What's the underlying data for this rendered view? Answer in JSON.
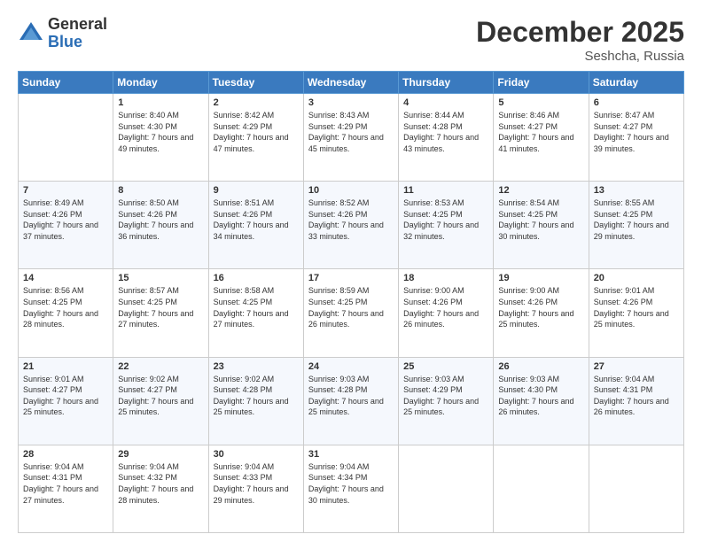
{
  "header": {
    "logo_general": "General",
    "logo_blue": "Blue",
    "month_title": "December 2025",
    "location": "Seshcha, Russia"
  },
  "weekdays": [
    "Sunday",
    "Monday",
    "Tuesday",
    "Wednesday",
    "Thursday",
    "Friday",
    "Saturday"
  ],
  "weeks": [
    [
      {
        "day": "",
        "sunrise": "",
        "sunset": "",
        "daylight": ""
      },
      {
        "day": "1",
        "sunrise": "Sunrise: 8:40 AM",
        "sunset": "Sunset: 4:30 PM",
        "daylight": "Daylight: 7 hours and 49 minutes."
      },
      {
        "day": "2",
        "sunrise": "Sunrise: 8:42 AM",
        "sunset": "Sunset: 4:29 PM",
        "daylight": "Daylight: 7 hours and 47 minutes."
      },
      {
        "day": "3",
        "sunrise": "Sunrise: 8:43 AM",
        "sunset": "Sunset: 4:29 PM",
        "daylight": "Daylight: 7 hours and 45 minutes."
      },
      {
        "day": "4",
        "sunrise": "Sunrise: 8:44 AM",
        "sunset": "Sunset: 4:28 PM",
        "daylight": "Daylight: 7 hours and 43 minutes."
      },
      {
        "day": "5",
        "sunrise": "Sunrise: 8:46 AM",
        "sunset": "Sunset: 4:27 PM",
        "daylight": "Daylight: 7 hours and 41 minutes."
      },
      {
        "day": "6",
        "sunrise": "Sunrise: 8:47 AM",
        "sunset": "Sunset: 4:27 PM",
        "daylight": "Daylight: 7 hours and 39 minutes."
      }
    ],
    [
      {
        "day": "7",
        "sunrise": "Sunrise: 8:49 AM",
        "sunset": "Sunset: 4:26 PM",
        "daylight": "Daylight: 7 hours and 37 minutes."
      },
      {
        "day": "8",
        "sunrise": "Sunrise: 8:50 AM",
        "sunset": "Sunset: 4:26 PM",
        "daylight": "Daylight: 7 hours and 36 minutes."
      },
      {
        "day": "9",
        "sunrise": "Sunrise: 8:51 AM",
        "sunset": "Sunset: 4:26 PM",
        "daylight": "Daylight: 7 hours and 34 minutes."
      },
      {
        "day": "10",
        "sunrise": "Sunrise: 8:52 AM",
        "sunset": "Sunset: 4:26 PM",
        "daylight": "Daylight: 7 hours and 33 minutes."
      },
      {
        "day": "11",
        "sunrise": "Sunrise: 8:53 AM",
        "sunset": "Sunset: 4:25 PM",
        "daylight": "Daylight: 7 hours and 32 minutes."
      },
      {
        "day": "12",
        "sunrise": "Sunrise: 8:54 AM",
        "sunset": "Sunset: 4:25 PM",
        "daylight": "Daylight: 7 hours and 30 minutes."
      },
      {
        "day": "13",
        "sunrise": "Sunrise: 8:55 AM",
        "sunset": "Sunset: 4:25 PM",
        "daylight": "Daylight: 7 hours and 29 minutes."
      }
    ],
    [
      {
        "day": "14",
        "sunrise": "Sunrise: 8:56 AM",
        "sunset": "Sunset: 4:25 PM",
        "daylight": "Daylight: 7 hours and 28 minutes."
      },
      {
        "day": "15",
        "sunrise": "Sunrise: 8:57 AM",
        "sunset": "Sunset: 4:25 PM",
        "daylight": "Daylight: 7 hours and 27 minutes."
      },
      {
        "day": "16",
        "sunrise": "Sunrise: 8:58 AM",
        "sunset": "Sunset: 4:25 PM",
        "daylight": "Daylight: 7 hours and 27 minutes."
      },
      {
        "day": "17",
        "sunrise": "Sunrise: 8:59 AM",
        "sunset": "Sunset: 4:25 PM",
        "daylight": "Daylight: 7 hours and 26 minutes."
      },
      {
        "day": "18",
        "sunrise": "Sunrise: 9:00 AM",
        "sunset": "Sunset: 4:26 PM",
        "daylight": "Daylight: 7 hours and 26 minutes."
      },
      {
        "day": "19",
        "sunrise": "Sunrise: 9:00 AM",
        "sunset": "Sunset: 4:26 PM",
        "daylight": "Daylight: 7 hours and 25 minutes."
      },
      {
        "day": "20",
        "sunrise": "Sunrise: 9:01 AM",
        "sunset": "Sunset: 4:26 PM",
        "daylight": "Daylight: 7 hours and 25 minutes."
      }
    ],
    [
      {
        "day": "21",
        "sunrise": "Sunrise: 9:01 AM",
        "sunset": "Sunset: 4:27 PM",
        "daylight": "Daylight: 7 hours and 25 minutes."
      },
      {
        "day": "22",
        "sunrise": "Sunrise: 9:02 AM",
        "sunset": "Sunset: 4:27 PM",
        "daylight": "Daylight: 7 hours and 25 minutes."
      },
      {
        "day": "23",
        "sunrise": "Sunrise: 9:02 AM",
        "sunset": "Sunset: 4:28 PM",
        "daylight": "Daylight: 7 hours and 25 minutes."
      },
      {
        "day": "24",
        "sunrise": "Sunrise: 9:03 AM",
        "sunset": "Sunset: 4:28 PM",
        "daylight": "Daylight: 7 hours and 25 minutes."
      },
      {
        "day": "25",
        "sunrise": "Sunrise: 9:03 AM",
        "sunset": "Sunset: 4:29 PM",
        "daylight": "Daylight: 7 hours and 25 minutes."
      },
      {
        "day": "26",
        "sunrise": "Sunrise: 9:03 AM",
        "sunset": "Sunset: 4:30 PM",
        "daylight": "Daylight: 7 hours and 26 minutes."
      },
      {
        "day": "27",
        "sunrise": "Sunrise: 9:04 AM",
        "sunset": "Sunset: 4:31 PM",
        "daylight": "Daylight: 7 hours and 26 minutes."
      }
    ],
    [
      {
        "day": "28",
        "sunrise": "Sunrise: 9:04 AM",
        "sunset": "Sunset: 4:31 PM",
        "daylight": "Daylight: 7 hours and 27 minutes."
      },
      {
        "day": "29",
        "sunrise": "Sunrise: 9:04 AM",
        "sunset": "Sunset: 4:32 PM",
        "daylight": "Daylight: 7 hours and 28 minutes."
      },
      {
        "day": "30",
        "sunrise": "Sunrise: 9:04 AM",
        "sunset": "Sunset: 4:33 PM",
        "daylight": "Daylight: 7 hours and 29 minutes."
      },
      {
        "day": "31",
        "sunrise": "Sunrise: 9:04 AM",
        "sunset": "Sunset: 4:34 PM",
        "daylight": "Daylight: 7 hours and 30 minutes."
      },
      {
        "day": "",
        "sunrise": "",
        "sunset": "",
        "daylight": ""
      },
      {
        "day": "",
        "sunrise": "",
        "sunset": "",
        "daylight": ""
      },
      {
        "day": "",
        "sunrise": "",
        "sunset": "",
        "daylight": ""
      }
    ]
  ]
}
